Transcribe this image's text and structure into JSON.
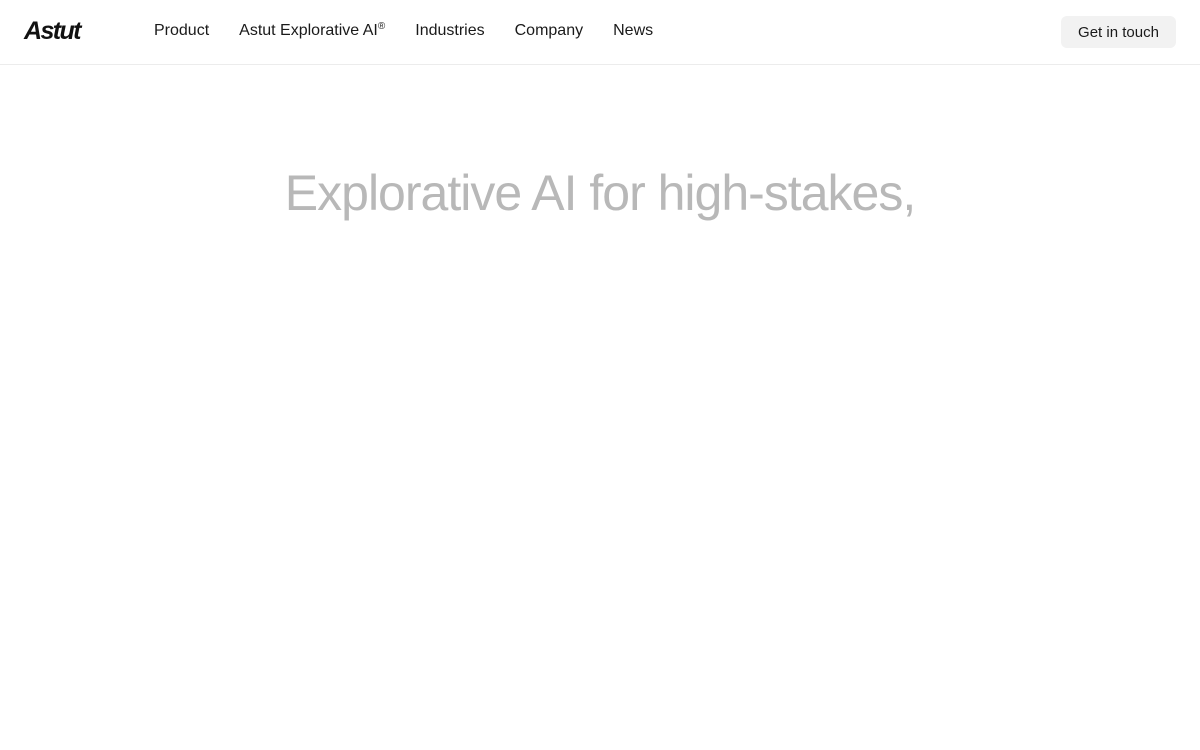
{
  "brand": {
    "logo_text": "Astut"
  },
  "nav": {
    "items": [
      {
        "label": "Product"
      },
      {
        "label": "Astut Explorative AI",
        "sup": "®"
      },
      {
        "label": "Industries"
      },
      {
        "label": "Company"
      },
      {
        "label": "News"
      }
    ],
    "cta_label": "Get in touch"
  },
  "hero": {
    "title": "Explorative AI for high-stakes,"
  },
  "colors": {
    "background": "#ffffff",
    "text": "#1a1a1a",
    "hero_text": "#b8b8b8",
    "cta_background": "#f2f2f2",
    "divider": "#ececec"
  }
}
